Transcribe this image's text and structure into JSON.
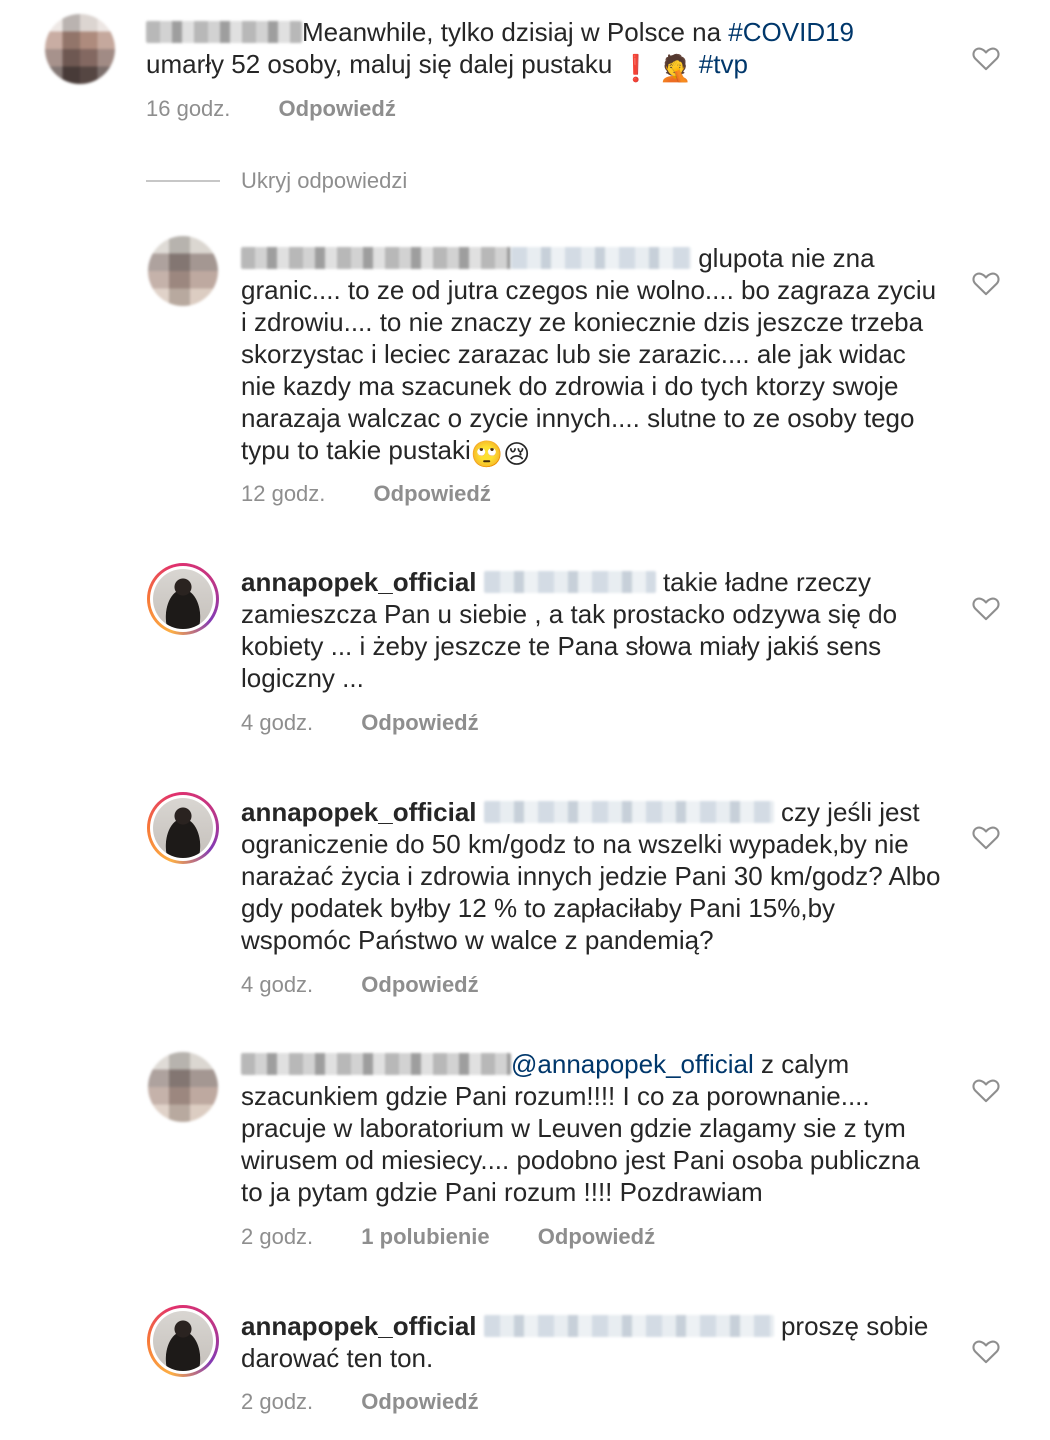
{
  "comments": [
    {
      "user": "",
      "text_before": "Meanwhile, tylko dzisiaj w Polsce na ",
      "tag1": "#COVID19",
      "text_mid": " umarły 52 osoby, maluj się dalej pustaku ",
      "emoji1": "❗",
      "emoji2": "🤦",
      "tag2": "#tvp",
      "time": "16 godz.",
      "reply": "Odpowiedź"
    },
    {
      "text": " glupota nie zna granic.... to ze od jutra czegos nie wolno.... bo zagraza zyciu i zdrowiu.... to nie znaczy ze koniecznie dzis jeszcze trzeba skorzystac i leciec zarazac lub sie zarazic.... ale jak widac nie kazdy ma szacunek do zdrowia i do tych ktorzy swoje narazaja walczac o zycie innych.... slutne to ze osoby tego typu to takie pustaki",
      "emoji": "🙄😢",
      "time": "12 godz.",
      "reply": "Odpowiedź"
    },
    {
      "user": "annapopek_official",
      "text": " takie ładne rzeczy zamieszcza Pan u siebie , a tak  prostacko odzywa się do kobiety ... i żeby jeszcze te Pana słowa miały jakiś sens logiczny ...",
      "time": "4 godz.",
      "reply": "Odpowiedź"
    },
    {
      "user": "annapopek_official",
      "text": " czy jeśli jest ograniczenie do 50 km/godz to na wszelki wypadek,by nie narażać życia i zdrowia innych jedzie Pani 30 km/godz?  Albo gdy podatek byłby 12 % to zapłaciłaby Pani 15%,by wspomóc Państwo w walce z pandemią?",
      "time": "4 godz.",
      "reply": "Odpowiedź"
    },
    {
      "mention": "@annapopek_official",
      "text": " z calym szacunkiem gdzie Pani rozum!!!! I co za porownanie.... pracuje w laboratorium w Leuven gdzie zlagamy sie z tym wirusem od miesiecy.... podobno jest Pani osoba publiczna to ja pytam gdzie Pani rozum !!!! Pozdrawiam",
      "time": "2 godz.",
      "likes": "1 polubienie",
      "reply": "Odpowiedź"
    },
    {
      "user": "annapopek_official",
      "text": " proszę sobie darować ten ton.",
      "time": "2 godz.",
      "reply": "Odpowiedź"
    }
  ],
  "hide_replies": "Ukryj odpowiedzi"
}
